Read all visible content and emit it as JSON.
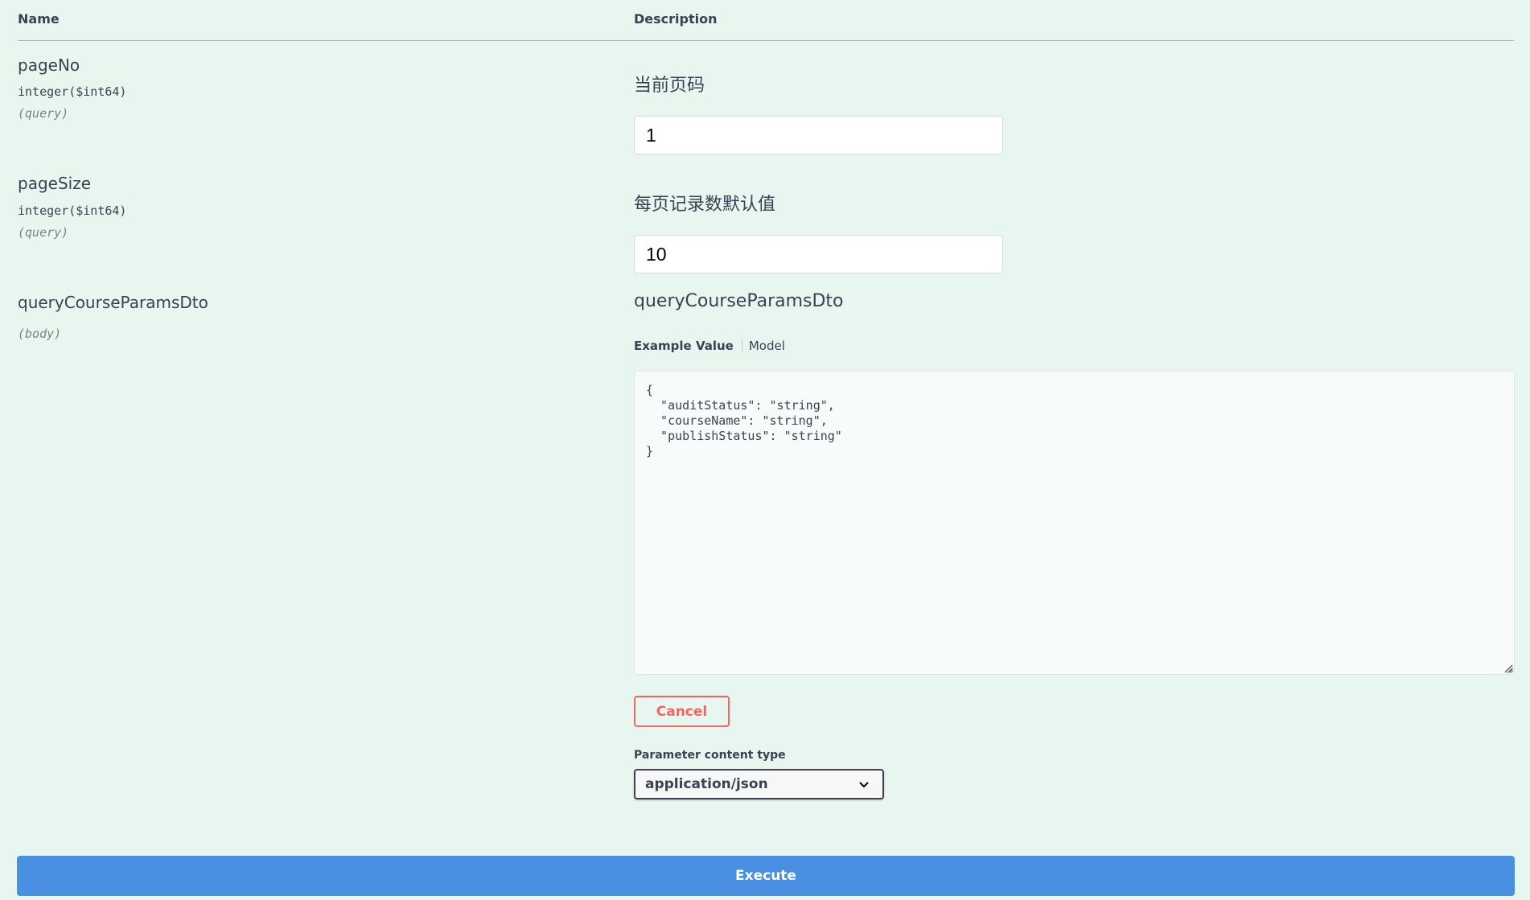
{
  "table": {
    "header_name": "Name",
    "header_description": "Description"
  },
  "params": [
    {
      "name": "pageNo",
      "type": "integer($int64)",
      "location": "(query)",
      "description": "当前页码",
      "value": "1"
    },
    {
      "name": "pageSize",
      "type": "integer($int64)",
      "location": "(query)",
      "description": "每页记录数默认值",
      "value": "10"
    },
    {
      "name": "queryCourseParamsDto",
      "location": "(body)",
      "description": "queryCourseParamsDto",
      "tab_example": "Example Value",
      "tab_model": "Model",
      "example_json": "{\n  \"auditStatus\": \"string\",\n  \"courseName\": \"string\",\n  \"publishStatus\": \"string\"\n}"
    }
  ],
  "cancel_label": "Cancel",
  "content_type": {
    "label": "Parameter content type",
    "selected": "application/json",
    "icon": "chevron-down-icon"
  },
  "execute_label": "Execute",
  "colors": {
    "background": "#e8f6f0",
    "cancel": "#ff6060",
    "execute": "#4990e2"
  }
}
